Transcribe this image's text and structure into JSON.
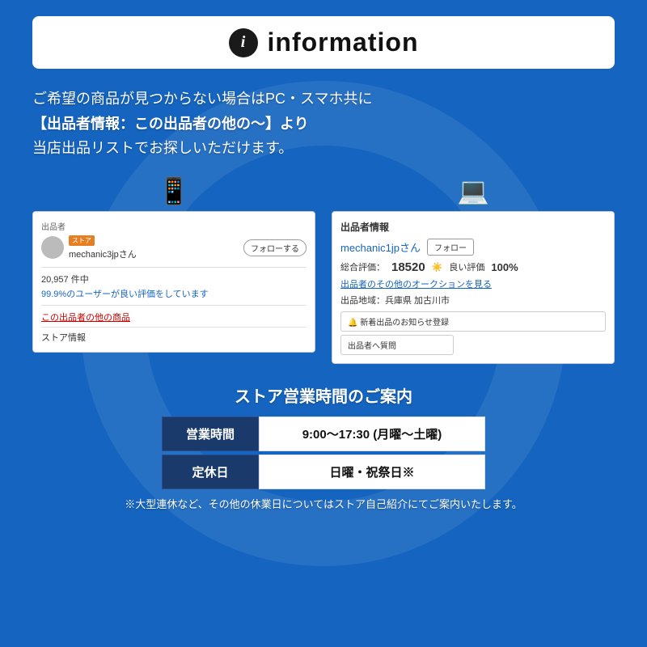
{
  "header": {
    "icon_label": "i",
    "title": "information"
  },
  "intro_text": {
    "line1": "ご希望の商品が見つからない場合はPC・スマホ共に",
    "line2": "【出品者情報：この出品者の他の〜】より",
    "line3": "当店出品リストでお探しいただけます。"
  },
  "mobile_screenshot": {
    "device_icon": "📱",
    "seller_section_label": "出品者",
    "store_badge": "ストア",
    "seller_name": "mechanic3jpさん",
    "follow_btn": "フォローする",
    "review_count": "20,957 件中",
    "review_pct": "99.9%のユーザーが良い評価をしています",
    "other_items_link": "この出品者の他の商品",
    "store_info": "ストア情報"
  },
  "pc_screenshot": {
    "device_icon": "💻",
    "seller_info_title": "出品者情報",
    "seller_name": "mechanic1jpさん",
    "follow_btn": "フォロー",
    "rating_label": "総合評価：",
    "rating_num": "18520",
    "good_label": "良い評価",
    "good_pct": "100%",
    "auction_link": "出品者のその他のオークションを見る",
    "location_label": "出品地域：兵庫県 加古川市",
    "notify_btn": "🔔 新着出品のお知らせ登録",
    "question_btn": "出品者へ質問"
  },
  "store_hours": {
    "title": "ストア営業時間のご案内",
    "rows": [
      {
        "label": "営業時間",
        "value": "9:00〜17:30 (月曜〜土曜)"
      },
      {
        "label": "定休日",
        "value": "日曜・祝祭日※"
      }
    ],
    "note": "※大型連休など、その他の休業日についてはストア自己紹介にてご案内いたします。"
  }
}
